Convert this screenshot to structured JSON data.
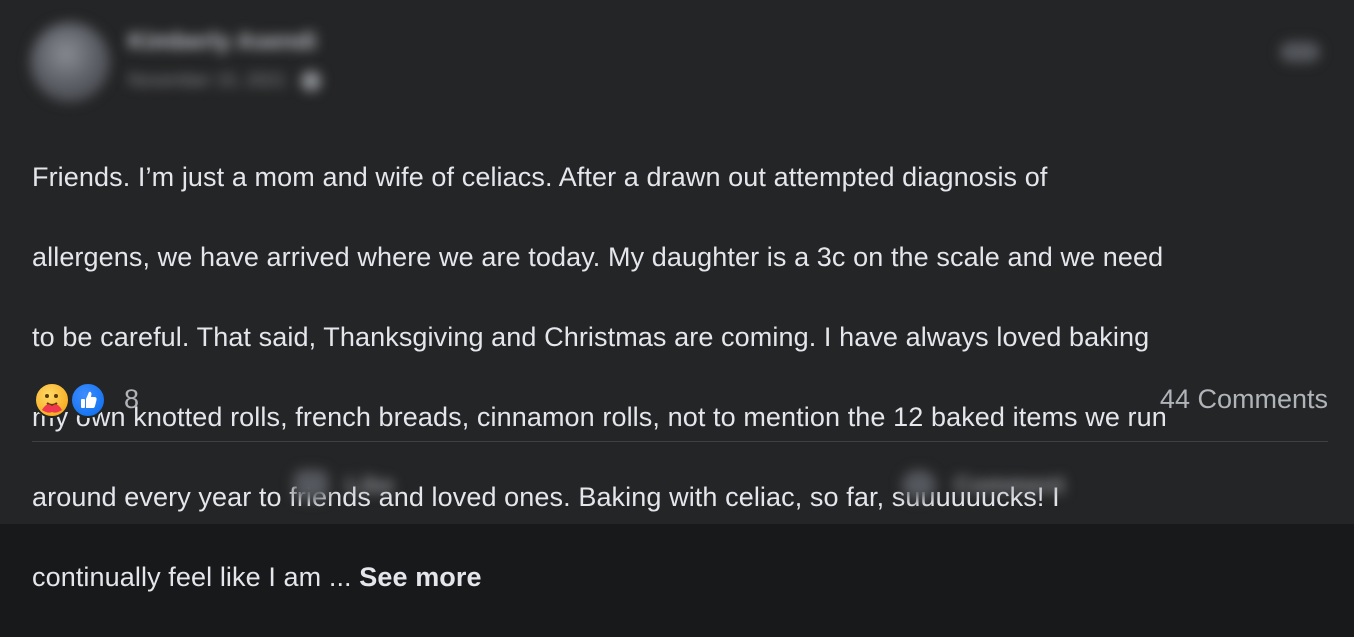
{
  "post": {
    "author_name": "Kimberly Asendi",
    "timestamp": "November 15, 2021",
    "text_lines": [
      "Friends. I’m just a mom and wife of celiacs.  After a drawn out attempted diagnosis of",
      "allergens, we have arrived where we are today. My daughter is a 3c on the scale and we need",
      "to be careful. That said, Thanksgiving and Christmas are coming. I have always loved baking",
      "my own knotted rolls, french breads, cinnamon rolls, not to mention the 12 baked items we run",
      "around every year to friends and loved ones. Baking with celiac, so far, suuuuuucks!  I",
      "continually feel like I am ... "
    ],
    "see_more_label": "See more"
  },
  "reactions": {
    "icons": [
      "care-reaction-icon",
      "like-reaction-icon"
    ],
    "count": "8",
    "comments_label": "44 Comments"
  },
  "actions": {
    "like_label": "Like",
    "comment_label": "Comment"
  },
  "colors": {
    "background": "#242526",
    "text": "#e4e6eb",
    "secondary_text": "#b0b3b8",
    "like_blue": "#1877f2",
    "care_yellow": "#f7b125"
  }
}
